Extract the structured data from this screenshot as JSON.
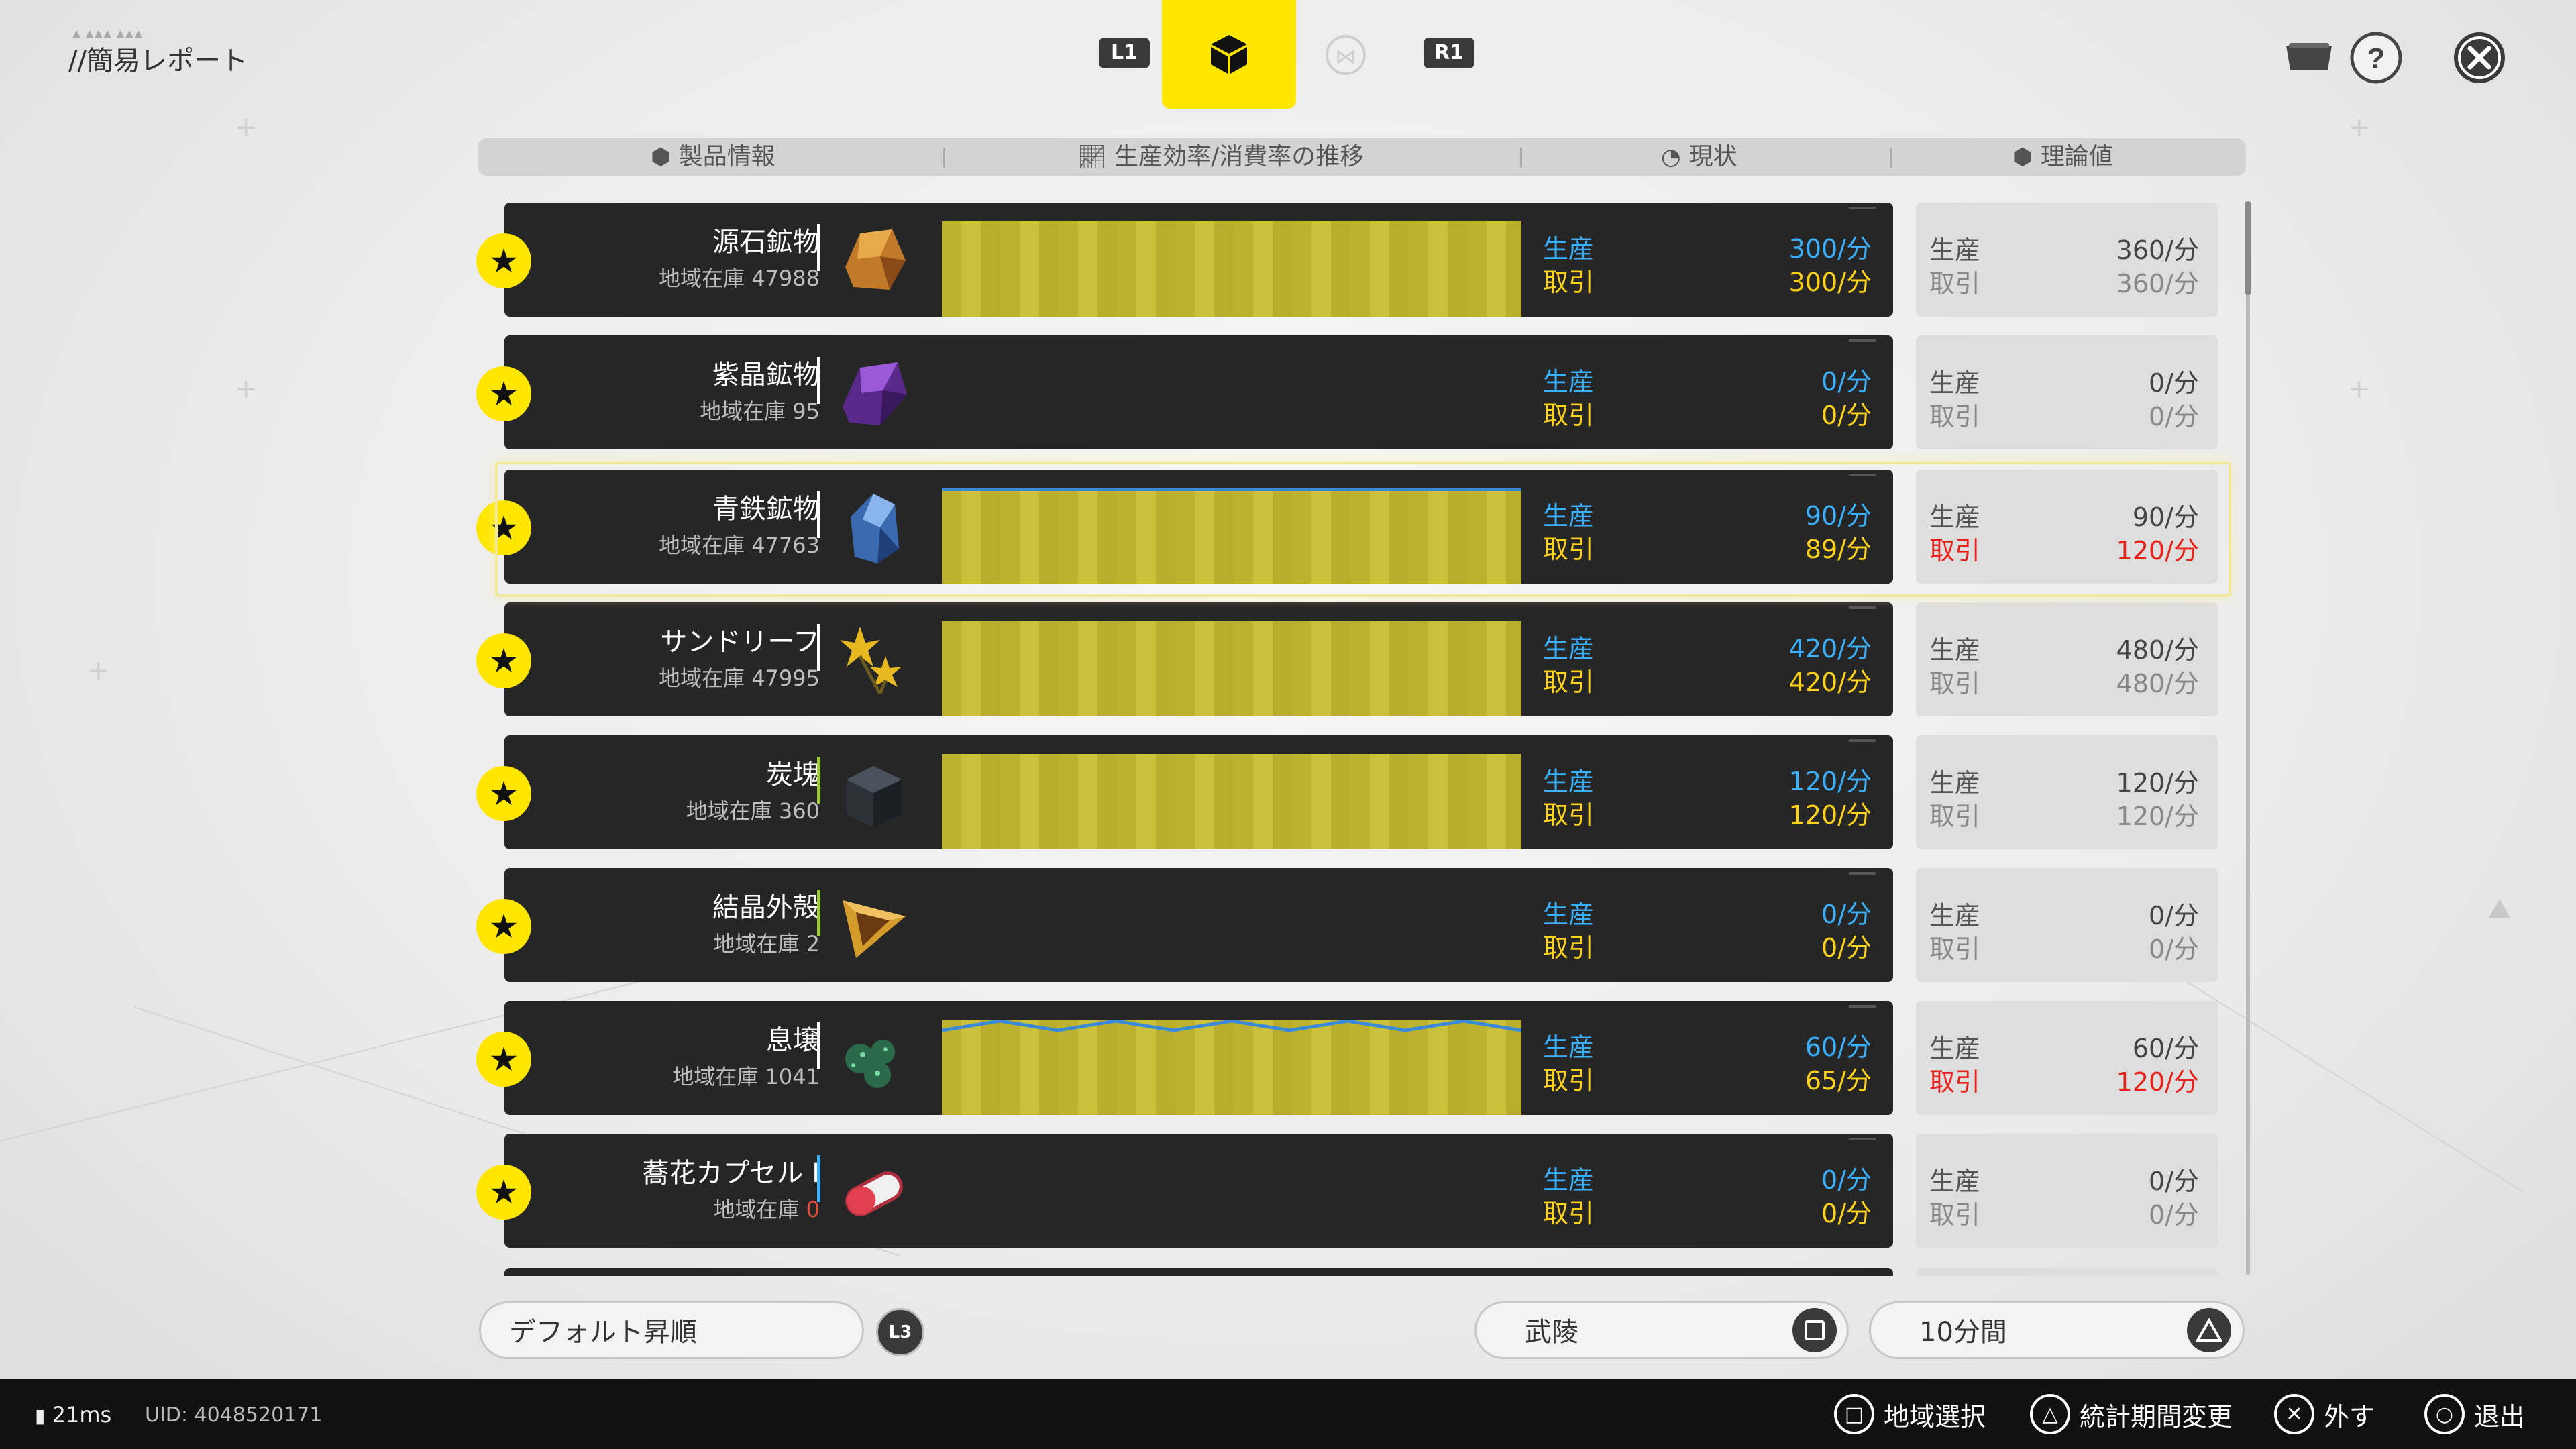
{
  "header": {
    "title": "//簡易レポート",
    "tab_left": "L1",
    "tab_right": "R1"
  },
  "columns": {
    "product": "製品情報",
    "trend": "生産効率/消費率の推移",
    "status": "現状",
    "theory": "理論値"
  },
  "labels": {
    "production": "生産",
    "trade": "取引"
  },
  "rows": [
    {
      "name": "源石鉱物",
      "stock_label": "地域在庫",
      "stock": "47988",
      "accent": "#ffffff",
      "icon": "orange-ore-icon",
      "has_chart": true,
      "prod": "300/分",
      "trade": "300/分",
      "t_prod": "360/分",
      "t_trade": "360/分",
      "t_red": false
    },
    {
      "name": "紫晶鉱物",
      "stock_label": "地域在庫",
      "stock": "95",
      "accent": "#ffffff",
      "icon": "amethyst-ore-icon",
      "has_chart": false,
      "prod": "0/分",
      "trade": "0/分",
      "t_prod": "0/分",
      "t_trade": "0/分",
      "t_red": false
    },
    {
      "name": "青鉄鉱物",
      "stock_label": "地域在庫",
      "stock": "47763",
      "accent": "#ffffff",
      "icon": "blue-iron-ore-icon",
      "has_chart": true,
      "prod": "90/分",
      "trade": "89/分",
      "t_prod": "90/分",
      "t_trade": "120/分",
      "t_red": true
    },
    {
      "name": "サンドリーフ",
      "stock_label": "地域在庫",
      "stock": "47995",
      "accent": "#ffffff",
      "icon": "sandleaf-icon",
      "has_chart": true,
      "prod": "420/分",
      "trade": "420/分",
      "t_prod": "480/分",
      "t_trade": "480/分",
      "t_red": false
    },
    {
      "name": "炭塊",
      "stock_label": "地域在庫",
      "stock": "360",
      "accent": "#9ccc3a",
      "icon": "carbon-block-icon",
      "has_chart": true,
      "prod": "120/分",
      "trade": "120/分",
      "t_prod": "120/分",
      "t_trade": "120/分",
      "t_red": false
    },
    {
      "name": "結晶外殻",
      "stock_label": "地域在庫",
      "stock": "2",
      "accent": "#9ccc3a",
      "icon": "crystal-shell-icon",
      "has_chart": false,
      "prod": "0/分",
      "trade": "0/分",
      "t_prod": "0/分",
      "t_trade": "0/分",
      "t_red": false
    },
    {
      "name": "息壌",
      "stock_label": "地域在庫",
      "stock": "1041",
      "accent": "#ffffff",
      "icon": "xirang-icon",
      "has_chart": true,
      "wavy": true,
      "prod": "60/分",
      "trade": "65/分",
      "t_prod": "60/分",
      "t_trade": "120/分",
      "t_red": true
    },
    {
      "name": "蕎花カプセル Ⅰ",
      "stock_label": "地域在庫",
      "stock": "0",
      "accent": "#3ab0ff",
      "icon": "capsule-icon",
      "has_chart": false,
      "stock_zero": true,
      "prod": "0/分",
      "trade": "0/分",
      "t_prod": "0/分",
      "t_trade": "0/分",
      "t_red": false
    }
  ],
  "controls": {
    "sort_label": "デフォルト昇順",
    "sort_button": "L3",
    "region_label": "武陵",
    "period_label": "10分間"
  },
  "footer": {
    "ping": "21ms",
    "uid": "UID: 4048520171",
    "actions": [
      {
        "glyph": "□",
        "label": "地域選択"
      },
      {
        "glyph": "△",
        "label": "統計期間変更"
      },
      {
        "glyph": "✕",
        "label": "外す"
      },
      {
        "glyph": "○",
        "label": "退出"
      }
    ]
  },
  "colors": {
    "accent_yellow": "#ffe600",
    "production_blue": "#3ab0ff",
    "trade_yellow": "#ffd21a",
    "warning_red": "#e8221a"
  }
}
